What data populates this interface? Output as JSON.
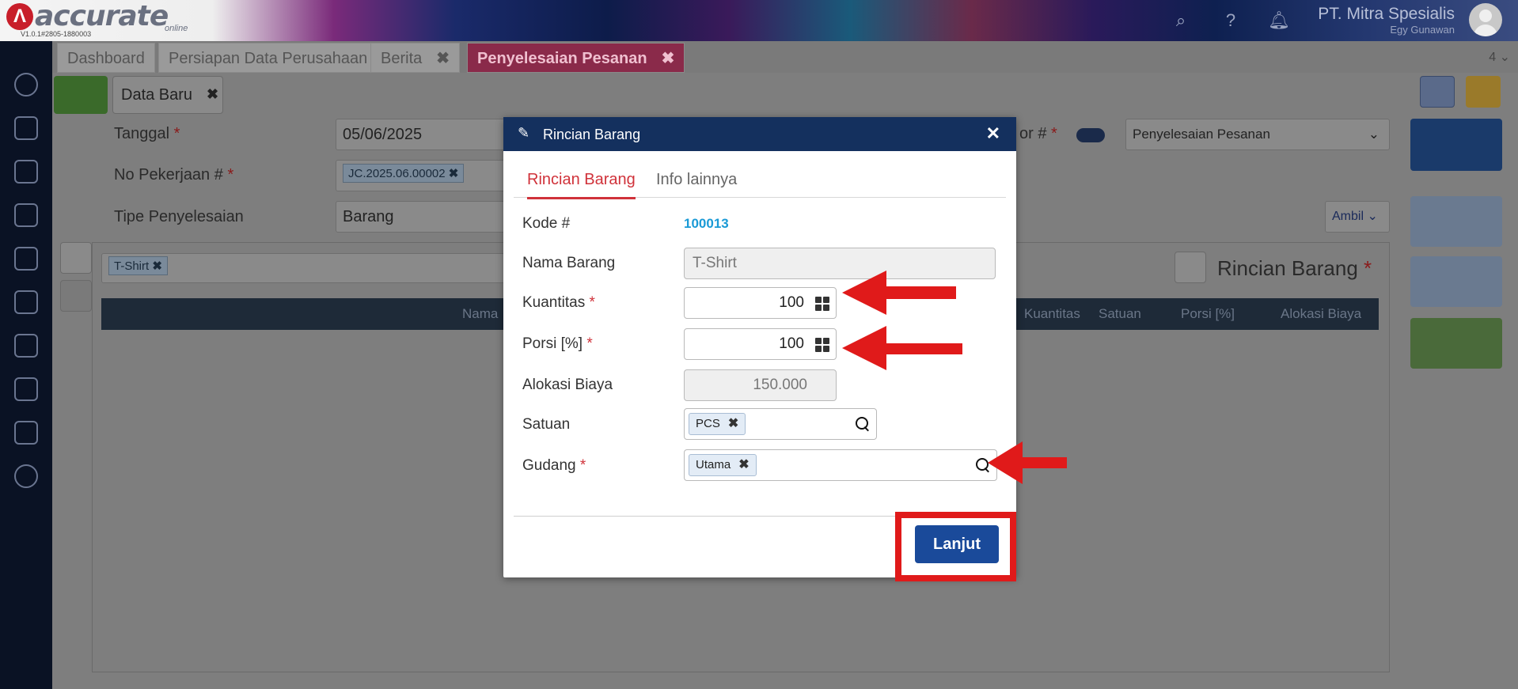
{
  "app": {
    "logo_text": "accurate",
    "logo_sub": "online",
    "version": "V1.0.1#2805-1880003",
    "company": "PT. Mitra Spesialis",
    "user": "Egy Gunawan"
  },
  "tabs": [
    {
      "label": "Dashboard"
    },
    {
      "label": "Persiapan Data Perusahaan"
    },
    {
      "label": "Berita"
    },
    {
      "label": "Penyelesaian Pesanan"
    }
  ],
  "tab_count": "4",
  "subtab": {
    "label": "Data Baru"
  },
  "form": {
    "tanggal_label": "Tanggal",
    "tanggal_value": "05/06/2025",
    "no_pekerjaan_label": "No Pekerjaan #",
    "no_pekerjaan_value": "JC.2025.06.00002",
    "tipe_label": "Tipe Penyelesaian",
    "tipe_value": "Barang",
    "nomor_label": "or #",
    "type_select": "Penyelesaian Pesanan",
    "ambil_label": "Ambil",
    "item_chip": "T-Shirt",
    "grid_title": "Rincian Barang",
    "columns": [
      "Nama",
      "Kuantitas",
      "Satuan",
      "Porsi [%]",
      "Alokasi Biaya"
    ]
  },
  "modal": {
    "title": "Rincian Barang",
    "tabs": [
      "Rincian Barang",
      "Info lainnya"
    ],
    "kode_label": "Kode #",
    "kode_value": "100013",
    "nama_label": "Nama Barang",
    "nama_value": "T-Shirt",
    "kuantitas_label": "Kuantitas",
    "kuantitas_value": "100",
    "porsi_label": "Porsi [%]",
    "porsi_value": "100",
    "alokasi_label": "Alokasi Biaya",
    "alokasi_value": "150.000",
    "satuan_label": "Satuan",
    "satuan_value": "PCS",
    "gudang_label": "Gudang",
    "gudang_value": "Utama",
    "submit_label": "Lanjut"
  },
  "colors": {
    "modal_header": "#14305e",
    "accent_red": "#d0323a",
    "primary_button": "#1a4a9a",
    "annotation_red": "#e01a1a"
  }
}
